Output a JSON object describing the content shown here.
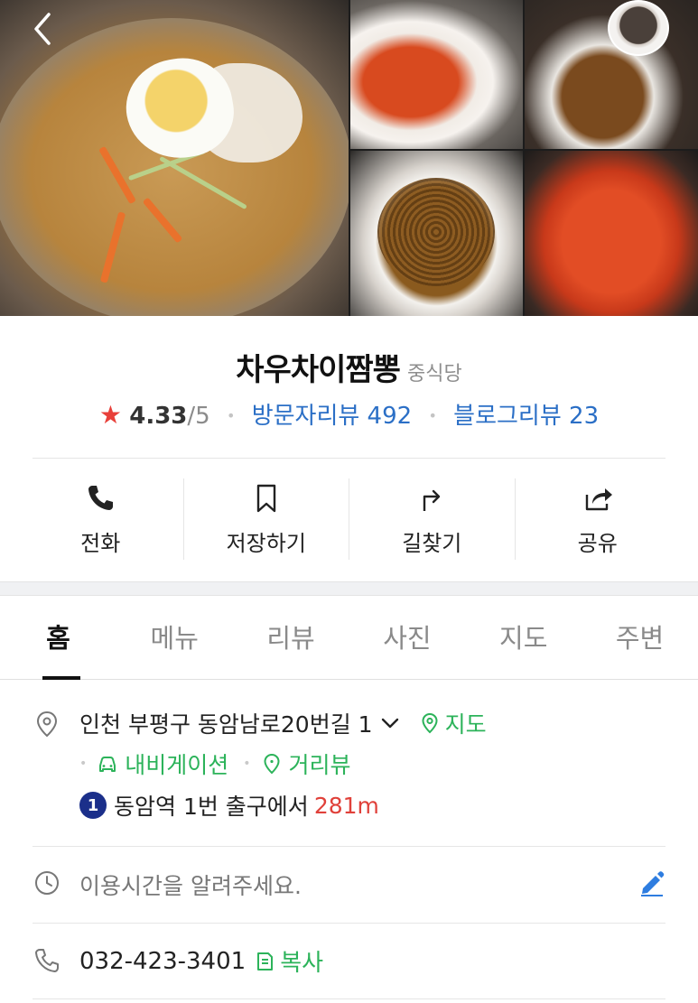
{
  "header": {
    "back_icon": "chevron-left-icon",
    "photos": [
      "main-cold-noodle-photo",
      "tteokbokki-photo",
      "jajangmyeon-photo",
      "jajang-noodle-photo",
      "jjamppong-photo"
    ]
  },
  "place": {
    "name": "차우차이짬뽕",
    "category": "중식당",
    "rating": "4.33",
    "rating_max": "/5",
    "visitor_reviews": "방문자리뷰 492",
    "blog_reviews": "블로그리뷰 23"
  },
  "actions": [
    {
      "label": "전화",
      "icon": "phone-icon"
    },
    {
      "label": "저장하기",
      "icon": "bookmark-icon"
    },
    {
      "label": "길찾기",
      "icon": "directions-icon"
    },
    {
      "label": "공유",
      "icon": "share-icon"
    }
  ],
  "tabs": [
    {
      "label": "홈",
      "active": true
    },
    {
      "label": "메뉴"
    },
    {
      "label": "리뷰"
    },
    {
      "label": "사진"
    },
    {
      "label": "지도"
    },
    {
      "label": "주변"
    }
  ],
  "info": {
    "address": "인천 부평구 동암남로20번길 1",
    "map_label": "지도",
    "navigation_label": "내비게이션",
    "streetview_label": "거리뷰",
    "subway_line": "1",
    "station_text": "동암역 1번 출구에서",
    "distance": "281m",
    "hours_placeholder": "이용시간을 알려주세요.",
    "phone": "032-423-3401",
    "copy_label": "복사"
  },
  "colors": {
    "accent_green": "#2cb35a",
    "link_blue": "#2b6fc6",
    "star_red": "#e8403a",
    "subway_line1": "#1b2f8a",
    "edit_blue": "#2e7de0"
  }
}
